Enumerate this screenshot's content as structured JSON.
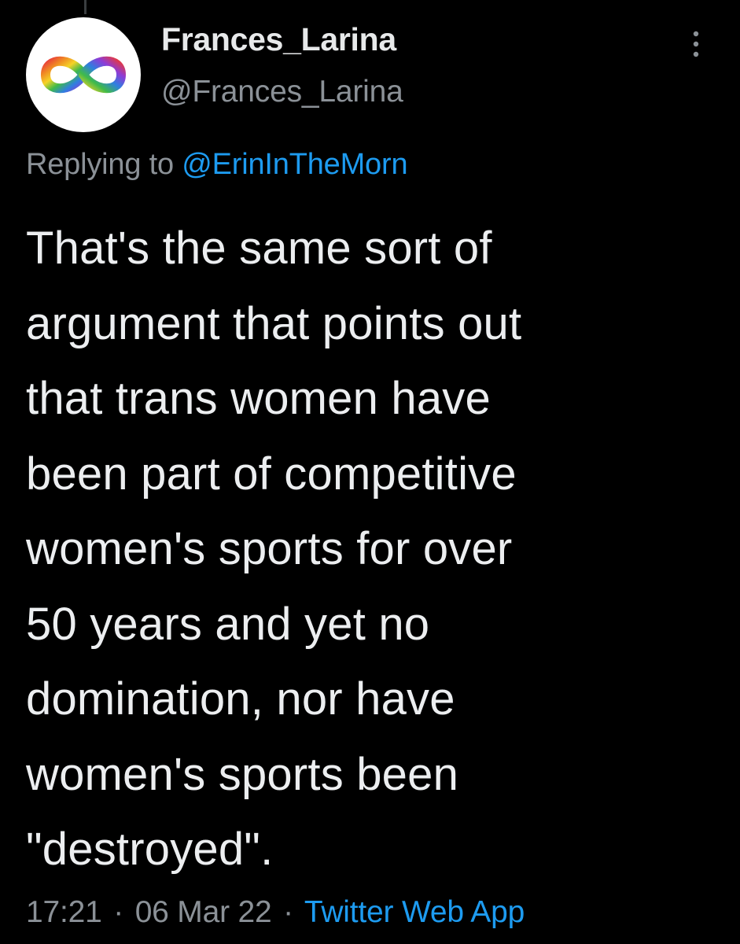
{
  "tweet": {
    "display_name": "Frances_Larina",
    "handle": "@Frances_Larina",
    "avatar_icon": "rainbow-infinity-icon",
    "more_icon": "vertical-ellipsis-icon",
    "replying_prefix": "Replying to",
    "replying_to": "@ErinInTheMorn",
    "text": "That's the same sort of\nargument that points out\nthat trans women have\nbeen part of competitive\nwomen's sports for over\n50 years and yet no\ndomination, nor have\nwomen's sports been\n\"destroyed\".",
    "time": "17:21",
    "separator": "·",
    "date": "06 Mar 22",
    "source": "Twitter Web App"
  },
  "colors": {
    "background": "#000000",
    "primary_text": "#e7e9ea",
    "secondary_text": "#8b9197",
    "link": "#1d9bf0"
  }
}
